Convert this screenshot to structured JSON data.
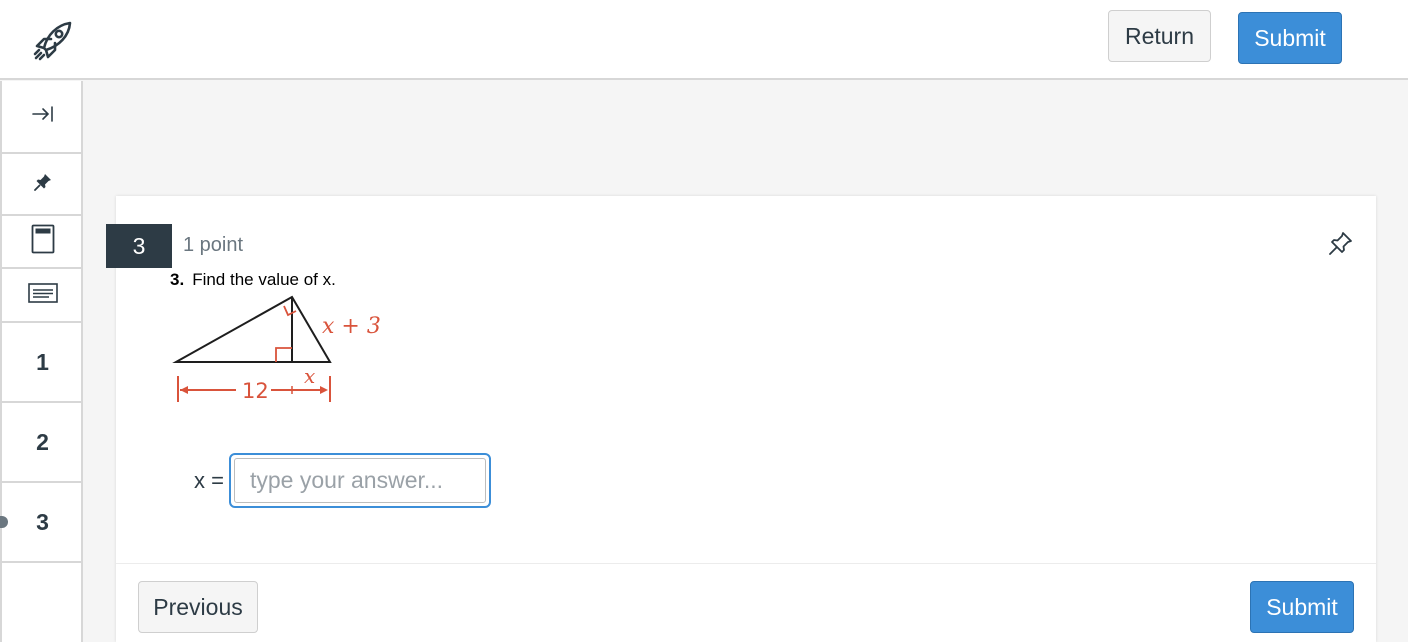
{
  "header": {
    "logo_icon": "rocket-icon",
    "return_label": "Return",
    "submit_label": "Submit"
  },
  "sidebar": {
    "tools": [
      {
        "icon": "collapse-sidebar-icon"
      },
      {
        "icon": "pin-icon"
      },
      {
        "icon": "calculator-icon"
      },
      {
        "icon": "keyboard-icon"
      }
    ],
    "questions": [
      "1",
      "2",
      "3"
    ],
    "current_question": "3"
  },
  "question": {
    "number_badge": "3",
    "points": "1 point",
    "prompt_number": "3.",
    "prompt_text": "Find the value of x.",
    "figure": {
      "side_label": "x + 3",
      "base_label_left": "12",
      "base_label_right": "x",
      "accent_color": "#d9533b"
    },
    "answer_label": "x =",
    "answer_placeholder": "type your answer...",
    "answer_value": ""
  },
  "footer": {
    "previous_label": "Previous",
    "submit_label": "Submit"
  },
  "colors": {
    "primary": "#3c8ed8",
    "dark": "#2d3b45",
    "border": "#d7d7d7"
  }
}
